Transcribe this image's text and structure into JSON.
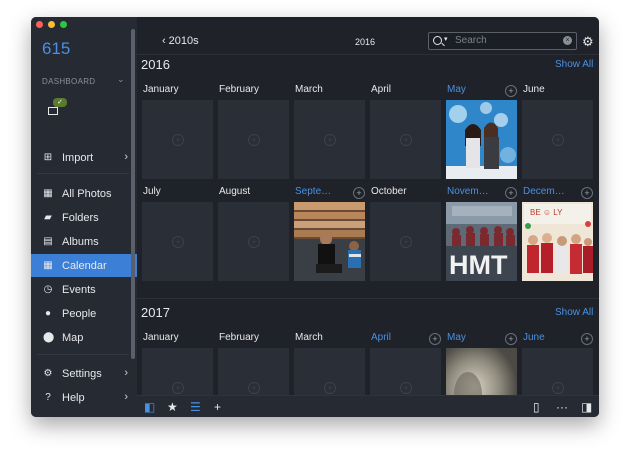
{
  "window": {
    "controls": [
      "close",
      "minimize",
      "zoom"
    ]
  },
  "sidebar": {
    "count": "615",
    "dashboard_label": "DASHBOARD",
    "device_badge": "✓",
    "items": [
      {
        "label": "Import",
        "icon": "import-icon",
        "chevron": true,
        "active": false
      },
      {
        "label": "All Photos",
        "icon": "grid-icon",
        "chevron": false,
        "active": false
      },
      {
        "label": "Folders",
        "icon": "folder-icon",
        "chevron": false,
        "active": false
      },
      {
        "label": "Albums",
        "icon": "albums-icon",
        "chevron": false,
        "active": false
      },
      {
        "label": "Calendar",
        "icon": "calendar-icon",
        "chevron": false,
        "active": true
      },
      {
        "label": "Events",
        "icon": "clock-icon",
        "chevron": false,
        "active": false
      },
      {
        "label": "People",
        "icon": "person-icon",
        "chevron": false,
        "active": false
      },
      {
        "label": "Map",
        "icon": "pin-icon",
        "chevron": false,
        "active": false
      },
      {
        "label": "Settings",
        "icon": "settings-icon",
        "chevron": true,
        "active": false
      },
      {
        "label": "Help",
        "icon": "help-icon",
        "chevron": true,
        "active": false
      }
    ]
  },
  "toolbar": {
    "back_label": "2010s",
    "title": "2016",
    "search_placeholder": "Search"
  },
  "years": [
    {
      "label": "2016",
      "show_all": "Show All",
      "months": [
        {
          "label": "January",
          "highlight": false,
          "photo": null
        },
        {
          "label": "February",
          "highlight": false,
          "photo": null
        },
        {
          "label": "March",
          "highlight": false,
          "photo": null
        },
        {
          "label": "April",
          "highlight": false,
          "photo": null
        },
        {
          "label": "May",
          "highlight": true,
          "photo": "two-women-blue-backdrop"
        },
        {
          "label": "June",
          "highlight": false,
          "photo": null
        },
        {
          "label": "July",
          "highlight": false,
          "photo": null
        },
        {
          "label": "August",
          "highlight": false,
          "photo": null
        },
        {
          "label": "Septe…",
          "highlight": true,
          "photo": "man-on-stairs"
        },
        {
          "label": "October",
          "highlight": false,
          "photo": null
        },
        {
          "label": "Novem…",
          "highlight": true,
          "photo": "group-hmt-sign"
        },
        {
          "label": "Decem…",
          "highlight": true,
          "photo": "group-red-dresses"
        }
      ]
    },
    {
      "label": "2017",
      "show_all": "Show All",
      "months": [
        {
          "label": "January",
          "highlight": false,
          "photo": null
        },
        {
          "label": "February",
          "highlight": false,
          "photo": null
        },
        {
          "label": "March",
          "highlight": false,
          "photo": null
        },
        {
          "label": "April",
          "highlight": true,
          "photo": null
        },
        {
          "label": "May",
          "highlight": true,
          "photo": "blurry-indoor"
        },
        {
          "label": "June",
          "highlight": true,
          "photo": null
        }
      ]
    }
  ],
  "photo_overlays": {
    "hmt_sign": "HMT"
  },
  "bottombar": {
    "left": [
      "sidebar-toggle-icon",
      "star-icon",
      "filter-icon",
      "add-icon"
    ],
    "right": [
      "clipboard-icon",
      "more-icon",
      "panel-toggle-icon"
    ]
  },
  "colors": {
    "accent": "#4a90e2",
    "active_item": "#3b7fd6",
    "sidebar": "#262a33",
    "main": "#1f2229"
  }
}
